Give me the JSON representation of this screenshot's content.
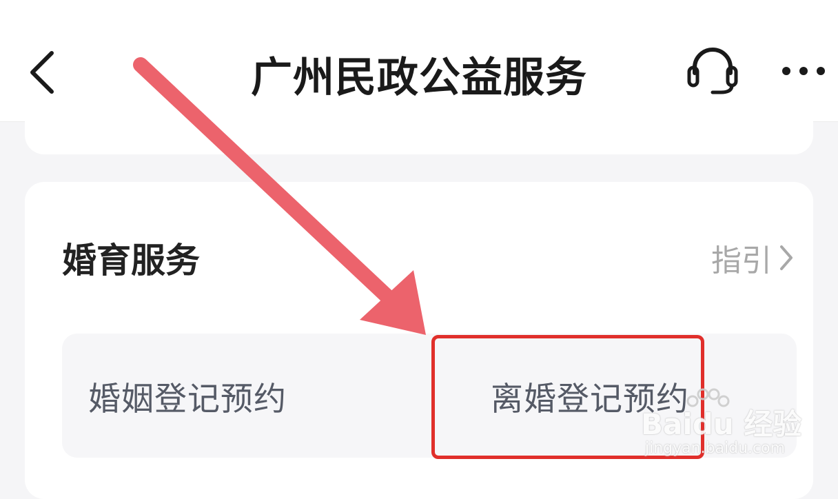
{
  "header": {
    "title": "广州民政公益服务",
    "back_icon": "chevron-left-icon",
    "support_icon": "headset-icon",
    "more_icon": "more-horizontal-icon"
  },
  "section": {
    "title": "婚育服务",
    "guide_label": "指引",
    "guide_icon": "chevron-right-icon",
    "tiles": [
      {
        "label": "婚姻登记预约"
      },
      {
        "label": "离婚登记预约"
      }
    ]
  },
  "annotation": {
    "highlight_color": "#e02f2b",
    "arrow_color": "#ec636c"
  },
  "watermark": {
    "brand": "Baidu 经验",
    "url": "jingyan.baidu.com"
  }
}
